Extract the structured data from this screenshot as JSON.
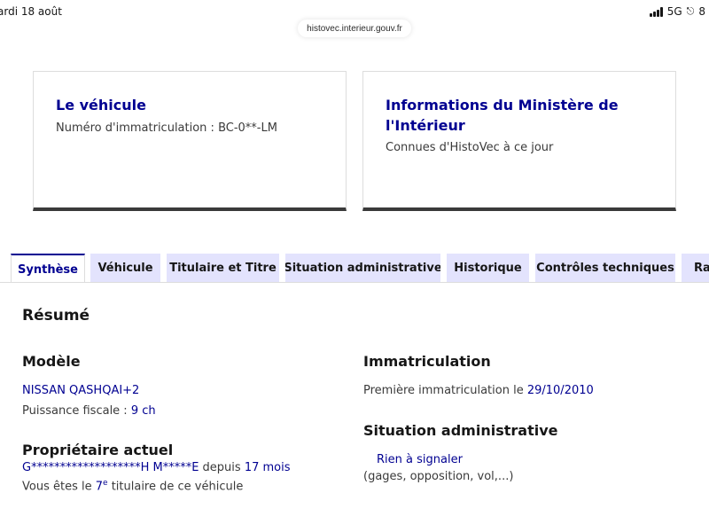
{
  "status": {
    "time": "ardi 18 août",
    "network": "5G",
    "battery_partial": "8"
  },
  "browser": {
    "url": "histovec.interieur.gouv.fr"
  },
  "cards": {
    "vehicle": {
      "title": "Le véhicule",
      "plate_label": "Numéro d'immatriculation : ",
      "plate_value": "BC-0**-LM"
    },
    "ministry": {
      "title_line1": "Informations du Ministère de",
      "title_line2": "l'Intérieur",
      "subtitle": "Connues d'HistoVec à ce jour"
    }
  },
  "tabs": [
    {
      "label": "Synthèse",
      "active": true
    },
    {
      "label": "Véhicule",
      "active": false
    },
    {
      "label": "Titulaire et Titre",
      "active": false
    },
    {
      "label": "Situation administrative",
      "active": false
    },
    {
      "label": "Historique",
      "active": false
    },
    {
      "label": "Contrôles techniques",
      "active": false
    },
    {
      "label": "Rap",
      "active": false
    }
  ],
  "summary": {
    "title": "Résumé",
    "model": {
      "heading": "Modèle",
      "name": "NISSAN QASHQAI+2",
      "power_label": "Puissance fiscale : ",
      "power_value": "9 ch"
    },
    "owner": {
      "heading": "Propriétaire actuel",
      "name": "G*******************H M*****E",
      "since_label": " depuis ",
      "since_value": "17 mois",
      "rank_prefix": "Vous êtes le ",
      "rank_value": "7",
      "rank_sup": "e",
      "rank_suffix": " titulaire de ce véhicule"
    },
    "registration": {
      "heading": "Immatriculation",
      "first_label": "Première immatriculation le ",
      "first_date": "29/10/2010"
    },
    "admin": {
      "heading": "Situation administrative",
      "status": "Rien à signaler",
      "detail": "(gages, opposition, vol,...)"
    }
  }
}
